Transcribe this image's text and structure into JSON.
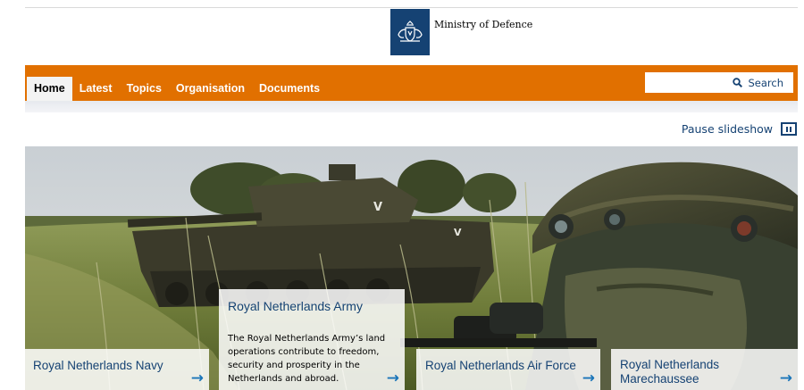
{
  "header": {
    "brand": "Ministry of Defence",
    "logo_icon": "coat-of-arms-icon",
    "ribbon_color": "#154273"
  },
  "nav": {
    "accent_color": "#e17000",
    "items": [
      {
        "label": "Home",
        "active": true
      },
      {
        "label": "Latest",
        "active": false
      },
      {
        "label": "Topics",
        "active": false
      },
      {
        "label": "Organisation",
        "active": false
      },
      {
        "label": "Documents",
        "active": false
      }
    ]
  },
  "search": {
    "value": "",
    "button_label": "Search",
    "icon": "search-icon"
  },
  "slideshow": {
    "pause_label": "Pause slideshow",
    "pause_icon": "pause-icon",
    "cards": [
      {
        "title": "Royal Netherlands Navy",
        "description": "",
        "arrow": "→"
      },
      {
        "title": "Royal Netherlands Army",
        "description": "The Royal Netherlands Army’s land operations contribute to freedom, security and prosperity in the Netherlands and abroad.",
        "arrow": "→"
      },
      {
        "title": "Royal Netherlands Air Force",
        "description": "",
        "arrow": "→"
      },
      {
        "title": "Royal Netherlands Marechaussee",
        "description": "",
        "arrow": "→"
      }
    ]
  }
}
